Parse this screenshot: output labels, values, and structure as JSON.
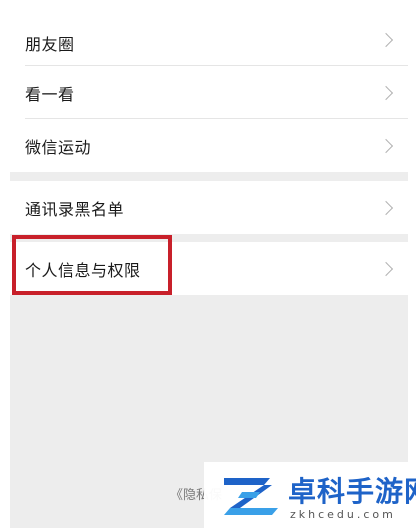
{
  "settings": {
    "items": [
      {
        "label": "朋友圈"
      },
      {
        "label": "看一看"
      },
      {
        "label": "微信运动"
      },
      {
        "label": "通讯录黑名单"
      },
      {
        "label": "个人信息与权限"
      }
    ],
    "footer_link": "《隐私保"
  },
  "highlight": {
    "color": "#c8202a",
    "target": "个人信息与权限"
  },
  "watermark": {
    "title": "卓科手游网",
    "subtitle": "zkhcedu.com",
    "color": "#1e63c8"
  }
}
